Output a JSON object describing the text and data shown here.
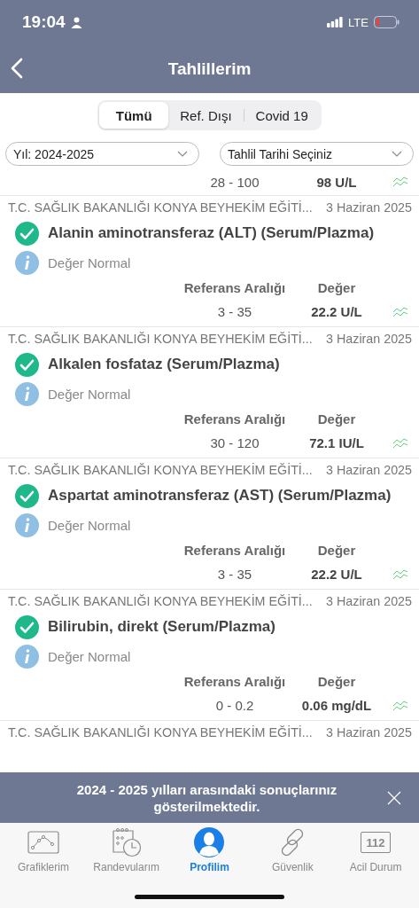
{
  "status_bar": {
    "time": "19:04",
    "network": "LTE"
  },
  "nav_bar": {
    "title": "Tahlillerim"
  },
  "segments": [
    {
      "label": "Tümü",
      "selected": true
    },
    {
      "label": "Ref. Dışı",
      "selected": false
    },
    {
      "label": "Covid 19",
      "selected": false
    }
  ],
  "filters": [
    {
      "value": "Yıl: 2024-2025"
    },
    {
      "value": "Tahlil Tarihi Seçiniz"
    }
  ],
  "partial_result": {
    "reference": "28 - 100",
    "value": "98 U/L"
  },
  "results": [
    {
      "institution": "T.C. SAĞLIK BAKANLIĞI KONYA BEYHEKİM EĞİTİ...",
      "date": "3 Haziran 2025",
      "name": "Alanin aminotransferaz (ALT) (Serum/Plazma)",
      "note": "Değer Normal",
      "reference_label": "Referans Aralığı",
      "value_label": "Değer",
      "reference": "3 - 35",
      "value": "22.2 U/L"
    },
    {
      "institution": "T.C. SAĞLIK BAKANLIĞI KONYA BEYHEKİM EĞİTİ...",
      "date": "3 Haziran 2025",
      "name": "Alkalen fosfataz (Serum/Plazma)",
      "note": "Değer Normal",
      "reference_label": "Referans Aralığı",
      "value_label": "Değer",
      "reference": "30 - 120",
      "value": "72.1 IU/L"
    },
    {
      "institution": "T.C. SAĞLIK BAKANLIĞI KONYA BEYHEKİM EĞİTİ...",
      "date": "3 Haziran 2025",
      "name": "Aspartat aminotransferaz (AST) (Serum/Plazma)",
      "note": "Değer Normal",
      "reference_label": "Referans Aralığı",
      "value_label": "Değer",
      "reference": "3 - 35",
      "value": "22.2 U/L"
    },
    {
      "institution": "T.C. SAĞLIK BAKANLIĞI KONYA BEYHEKİM EĞİTİ...",
      "date": "3 Haziran 2025",
      "name": "Bilirubin, direkt (Serum/Plazma)",
      "note": "Değer Normal",
      "reference_label": "Referans Aralığı",
      "value_label": "Değer",
      "reference": "0 - 0.2",
      "value": "0.06 mg/dL"
    },
    {
      "institution": "T.C. SAĞLIK BAKANLIĞI KONYA BEYHEKİM EĞİTİ...",
      "date": "3 Haziran 2025"
    }
  ],
  "banner": {
    "text": "2024 - 2025 yılları arasındaki sonuçlarınız gösterilmektedir."
  },
  "tabs": [
    {
      "label": "Grafiklerim",
      "kind": "chart",
      "selected": false
    },
    {
      "label": "Randevularım",
      "kind": "calendar",
      "selected": false
    },
    {
      "label": "Profilim",
      "kind": "person",
      "selected": true
    },
    {
      "label": "Güvenlik",
      "kind": "link",
      "selected": false
    },
    {
      "label": "Acil Durum",
      "kind": "badge",
      "badge_text": "112",
      "selected": false
    }
  ]
}
